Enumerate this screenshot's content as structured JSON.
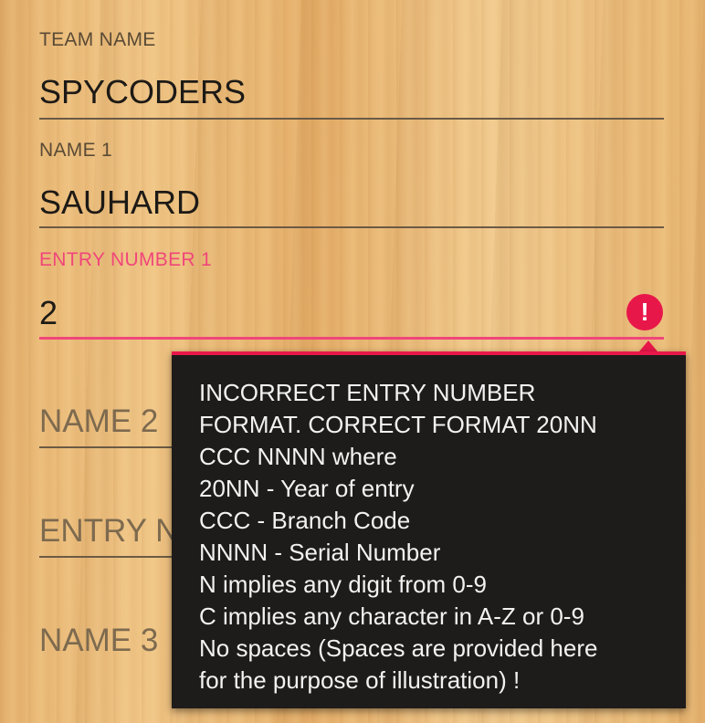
{
  "form": {
    "team_name": {
      "label": "TEAM NAME",
      "value": "SPYCODERS"
    },
    "name1": {
      "label": "NAME 1",
      "value": "SAUHARD"
    },
    "entry_number1": {
      "label": "ENTRY NUMBER 1",
      "value": "2",
      "error_icon": "exclamation-circle-icon",
      "error_icon_glyph": "!"
    },
    "name2": {
      "placeholder": "NAME 2"
    },
    "entry_number2": {
      "placeholder": "ENTRY NUMBER 2"
    },
    "name3": {
      "placeholder": "NAME 3"
    }
  },
  "error_tooltip": {
    "lines": [
      "INCORRECT ENTRY NUMBER",
      "FORMAT. CORRECT FORMAT 20NN",
      "CCC NNNN where",
      "20NN - Year of entry",
      "CCC - Branch Code",
      "NNNN - Serial Number",
      "N implies any digit from 0-9",
      "C implies any character in A-Z or 0-9",
      "No spaces (Spaces are provided here",
      "for the purpose of illustration) !"
    ]
  },
  "colors": {
    "error": "#e8174a",
    "error_label": "#f0467a",
    "tooltip_bg": "#1e1c1a",
    "text_dark": "#1d1a16"
  }
}
